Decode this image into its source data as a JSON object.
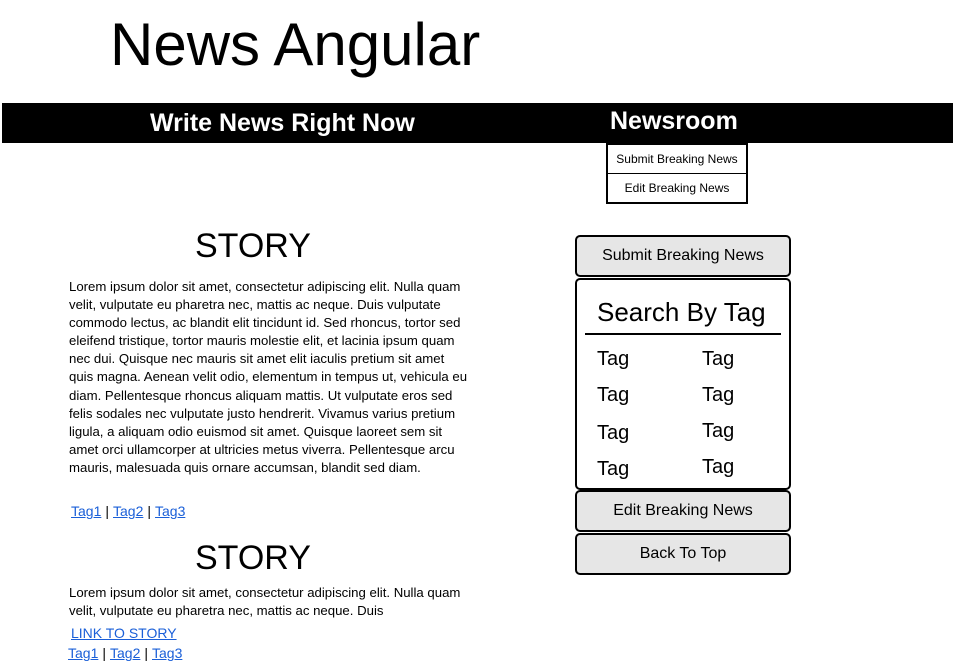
{
  "site": {
    "title": "News Angular"
  },
  "nav": {
    "write_label": "Write News Right Now",
    "newsroom_label": "Newsroom",
    "dropdown": [
      "Submit Breaking News",
      "Edit Breaking News"
    ]
  },
  "stories": [
    {
      "title": "STORY",
      "body": "Lorem ipsum dolor sit amet, consectetur adipiscing elit. Nulla quam velit, vulputate eu pharetra nec, mattis ac neque. Duis vulputate commodo lectus, ac blandit elit tincidunt id. Sed rhoncus, tortor sed eleifend tristique, tortor mauris molestie elit, et lacinia ipsum quam nec dui. Quisque nec mauris sit amet elit iaculis pretium sit amet quis magna. Aenean velit odio, elementum in tempus ut, vehicula eu diam. Pellentesque rhoncus aliquam mattis. Ut vulputate eros sed felis sodales nec vulputate justo hendrerit. Vivamus varius pretium ligula, a aliquam odio euismod sit amet. Quisque laoreet sem sit amet orci ullamcorper at ultricies metus viverra. Pellentesque arcu mauris, malesuada quis ornare accumsan, blandit sed diam.",
      "tags": [
        "Tag1",
        "Tag2",
        "Tag3"
      ]
    },
    {
      "title": "STORY",
      "body": "Lorem ipsum dolor sit amet, consectetur adipiscing elit. Nulla quam velit, vulputate eu pharetra nec, mattis ac neque. Duis",
      "link_label": "LINK TO STORY",
      "tags": [
        "Tag1",
        "Tag2",
        "Tag3"
      ]
    }
  ],
  "tag_separator": "|",
  "sidebar": {
    "submit_label": "Submit Breaking News",
    "search_title": "Search By Tag",
    "tags": [
      "Tag",
      "Tag",
      "Tag",
      "Tag",
      "Tag",
      "Tag",
      "Tag",
      "Tag"
    ],
    "edit_label": "Edit Breaking News",
    "back_label": "Back To Top"
  }
}
